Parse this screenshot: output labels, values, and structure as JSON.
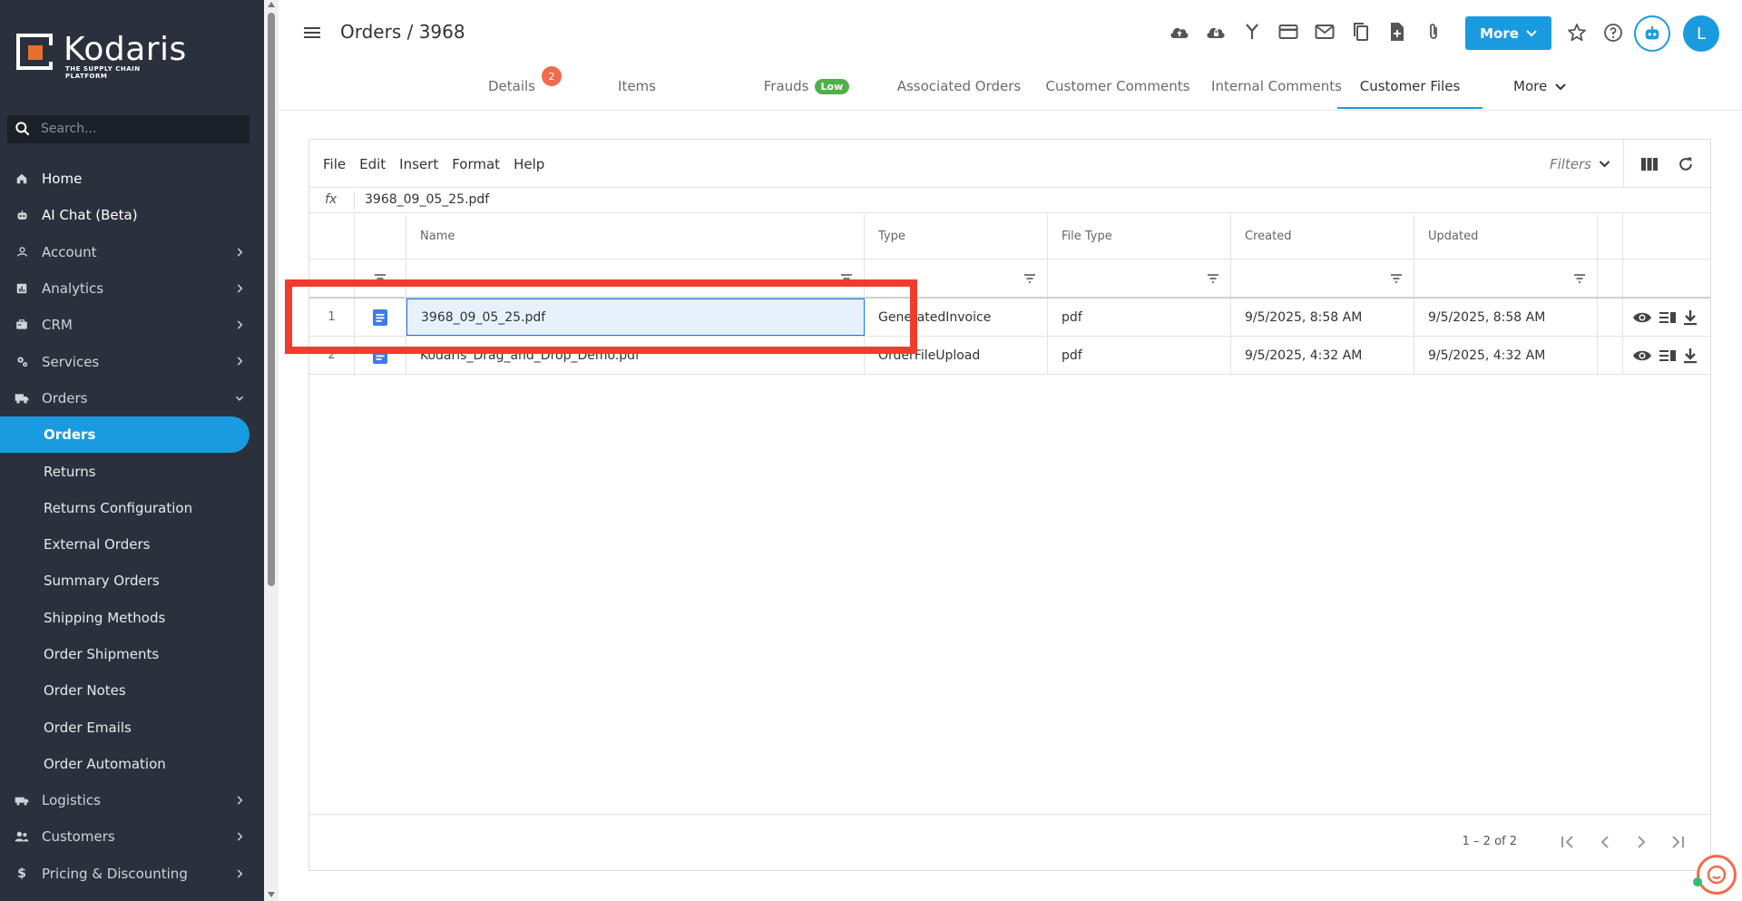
{
  "brand": {
    "name": "Kodaris",
    "tagline": "THE SUPPLY CHAIN PLATFORM",
    "accent": "#1a9be0",
    "logo_orange": "#e76f2f"
  },
  "search": {
    "placeholder": "Search..."
  },
  "sidebar": {
    "items": [
      {
        "label": "Home",
        "icon": "home-icon",
        "expandable": false
      },
      {
        "label": "AI Chat (Beta)",
        "icon": "robot-icon",
        "expandable": false
      },
      {
        "label": "Account",
        "icon": "person-icon",
        "expandable": true
      },
      {
        "label": "Analytics",
        "icon": "analytics-icon",
        "expandable": true
      },
      {
        "label": "CRM",
        "icon": "crm-icon",
        "expandable": true
      },
      {
        "label": "Services",
        "icon": "services-icon",
        "expandable": true
      },
      {
        "label": "Orders",
        "icon": "truck-icon",
        "expandable": true,
        "expanded": true
      }
    ],
    "orders_sub": [
      {
        "label": "Orders",
        "active": true
      },
      {
        "label": "Returns"
      },
      {
        "label": "Returns Configuration"
      },
      {
        "label": "External Orders"
      },
      {
        "label": "Summary Orders"
      },
      {
        "label": "Shipping Methods"
      },
      {
        "label": "Order Shipments"
      },
      {
        "label": "Order Notes"
      },
      {
        "label": "Order Emails"
      },
      {
        "label": "Order Automation"
      }
    ],
    "items_after": [
      {
        "label": "Logistics",
        "icon": "logistics-icon"
      },
      {
        "label": "Customers",
        "icon": "customers-icon"
      },
      {
        "label": "Pricing & Discounting",
        "icon": "dollar-icon"
      }
    ]
  },
  "header": {
    "title": "Orders / 3968",
    "more_label": "More",
    "avatar_initial": "L"
  },
  "tabs": [
    {
      "label": "Details",
      "badge": "2"
    },
    {
      "label": "Items"
    },
    {
      "label": "Frauds",
      "pill": "Low"
    },
    {
      "label": "Associated Orders"
    },
    {
      "label": "Customer Comments"
    },
    {
      "label": "Internal Comments"
    },
    {
      "label": "Customer Files",
      "active": true
    },
    {
      "label": "More"
    }
  ],
  "toolbar": {
    "menu": [
      "File",
      "Edit",
      "Insert",
      "Format",
      "Help"
    ],
    "filters_label": "Filters"
  },
  "formula_bar": {
    "fx": "fx",
    "value": "3968_09_05_25.pdf"
  },
  "table": {
    "columns": [
      "Name",
      "Type",
      "File Type",
      "Created",
      "Updated"
    ],
    "rows": [
      {
        "num": "1",
        "name": "3968_09_05_25.pdf",
        "type": "GeneratedInvoice",
        "file_type": "pdf",
        "created": "9/5/2025, 8:58 AM",
        "updated": "9/5/2025, 8:58 AM"
      },
      {
        "num": "2",
        "name": "Kodaris_Drag_and_Drop_Demo.pdf",
        "type": "OrderFileUpload",
        "file_type": "pdf",
        "created": "9/5/2025, 4:32 AM",
        "updated": "9/5/2025, 4:32 AM"
      }
    ]
  },
  "pager": {
    "count": "1 – 2 of 2"
  }
}
